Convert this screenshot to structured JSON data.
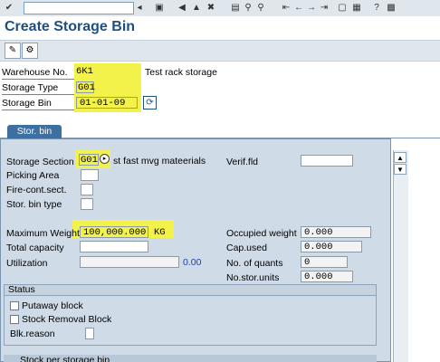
{
  "toolbar": {
    "command_field": "",
    "icons": [
      "enter-icon",
      "save-icon",
      "back-icon",
      "exit-icon",
      "cancel-icon",
      "print-icon",
      "find-icon",
      "find-next-icon",
      "first-page-icon",
      "prev-page-icon",
      "next-page-icon",
      "last-page-icon",
      "new-session-icon",
      "shortcut-icon",
      "help-icon",
      "layout-icon"
    ]
  },
  "page": {
    "title": "Create Storage Bin"
  },
  "header": {
    "warehouse_label": "Warehouse No.",
    "warehouse_value": "6K1",
    "warehouse_desc": "Test rack storage",
    "storage_type_label": "Storage Type",
    "storage_type_value": "G01",
    "storage_bin_label": "Storage Bin",
    "storage_bin_value": "01-01-09"
  },
  "tabs": [
    {
      "label": "Stor. bin"
    }
  ],
  "form": {
    "storage_section_label": "Storage Section",
    "storage_section_value": "G01",
    "storage_section_desc": "st fast mvg mateerials",
    "verif_label": "Verif.fld",
    "verif_value": "",
    "picking_area_label": "Picking Area",
    "fire_cont_label": "Fire-cont.sect.",
    "bin_type_label": "Stor. bin type",
    "max_weight_label": "Maximum Weight",
    "max_weight_value": "100,000.000",
    "max_weight_unit": "KG",
    "total_capacity_label": "Total capacity",
    "utilization_label": "Utilization",
    "utilization_value": "0.00",
    "occupied_weight_label": "Occupied weight",
    "occupied_weight_value": "0.000",
    "cap_used_label": "Cap.used",
    "cap_used_value": "0.000",
    "no_quants_label": "No. of quants",
    "no_quants_value": "0",
    "no_stor_units_label": "No.stor.units",
    "no_stor_units_value": "0.000"
  },
  "status": {
    "title": "Status",
    "putaway_block": "Putaway block",
    "stock_removal_block": "Stock Removal Block",
    "blk_reason_label": "Blk.reason"
  },
  "bottom": {
    "label": "Stock per storage bin"
  }
}
